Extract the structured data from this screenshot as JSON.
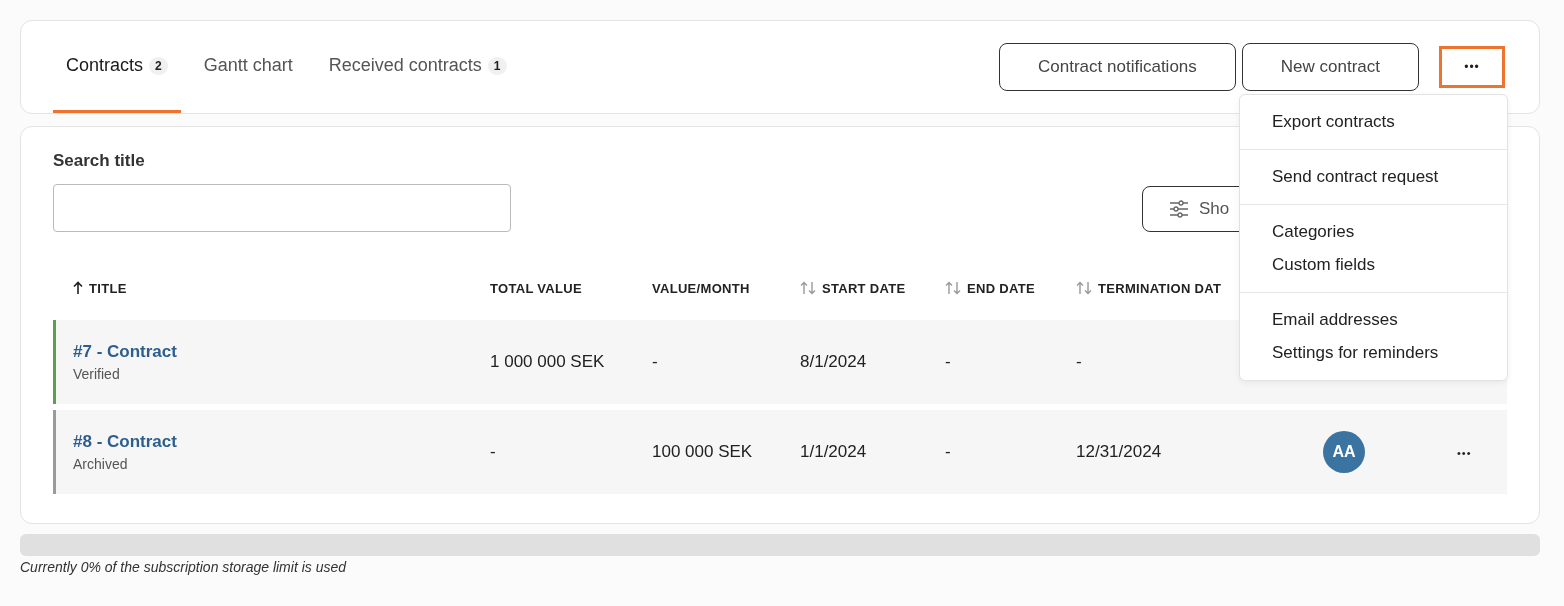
{
  "tabs": [
    {
      "label": "Contracts",
      "count": "2",
      "selected": true
    },
    {
      "label": "Gantt chart",
      "selected": false
    },
    {
      "label": "Received contracts",
      "count": "1",
      "selected": false
    }
  ],
  "header_buttons": [
    "Contract notifications",
    "New contract"
  ],
  "more_button": {
    "label": "•••",
    "selected": true
  },
  "menu": [
    [
      "Export contracts"
    ],
    [
      "Send contract request"
    ],
    [
      "Categories",
      "Custom fields"
    ],
    [
      "Email addresses",
      "Settings for reminders"
    ]
  ],
  "search": {
    "label": "Search title"
  },
  "filter_button": "Sho",
  "table": {
    "columns": [
      {
        "label": "TITLE",
        "sorted": true,
        "sortable": true
      },
      {
        "label": "TOTAL VALUE",
        "sortable": false
      },
      {
        "label": "VALUE/MONTH",
        "sortable": false
      },
      {
        "label": "START DATE",
        "sorted": false,
        "sortable": true
      },
      {
        "label": "END DATE",
        "sorted": false,
        "sortable": true
      },
      {
        "label": "TERMINATION DAT",
        "sorted": false,
        "sortable": true
      }
    ],
    "rows": [
      {
        "title": "#7 - Contract",
        "status": "Verified",
        "color": "#5e9e4f",
        "total_value": "1 000 000 SEK",
        "value_month": "-",
        "start_date": "8/1/2024",
        "end_date": "-",
        "termination_date": "-"
      },
      {
        "title": "#8 - Contract",
        "status": "Archived",
        "color": "#9a9a9a",
        "total_value": "-",
        "value_month": "100 000 SEK",
        "start_date": "1/1/2024",
        "end_date": "-",
        "termination_date": "12/31/2024",
        "initials": "AA",
        "actions_label": "•••"
      }
    ]
  },
  "storage": {
    "level": 0,
    "text": "Currently 0% of the subscription storage limit is used"
  }
}
